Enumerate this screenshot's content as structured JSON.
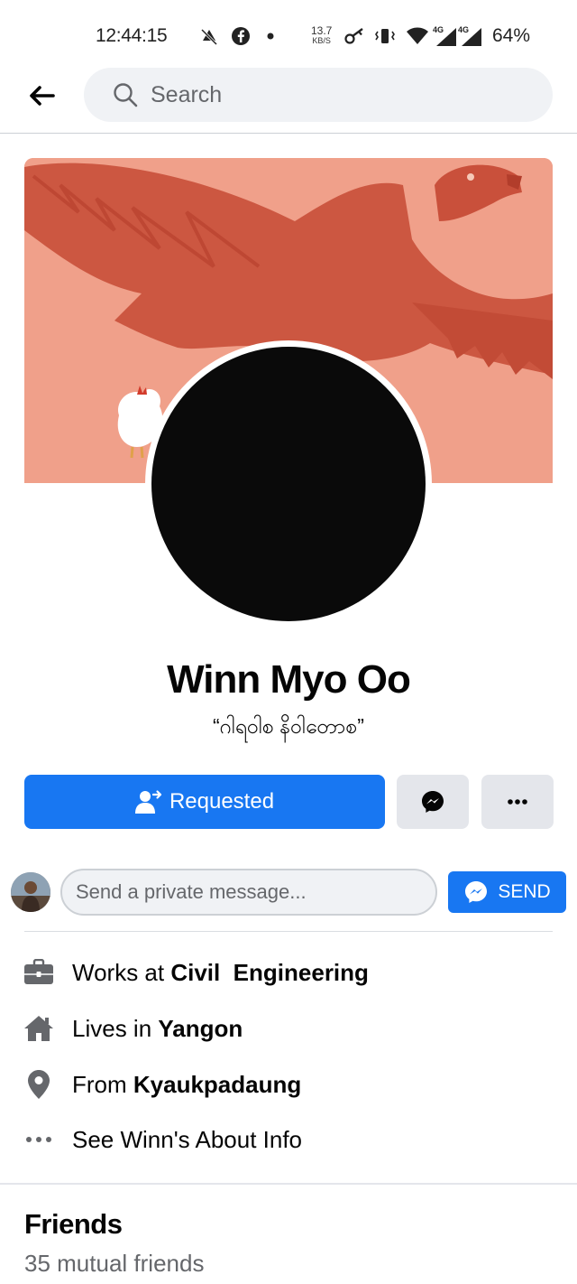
{
  "status_bar": {
    "time": "12:44:15",
    "speed_value": "13.7",
    "speed_unit": "KB/S",
    "network_1": "4G",
    "network_2": "4G",
    "battery": "64%"
  },
  "top_bar": {
    "search_placeholder": "Search"
  },
  "profile": {
    "name": "Winn Myo Oo",
    "bio": "“ဂါရဝါစ နိဝါတောစ”"
  },
  "actions": {
    "requested_label": "Requested"
  },
  "message": {
    "placeholder": "Send a private message...",
    "send_label": "SEND"
  },
  "info": {
    "work_prefix": "Works at ",
    "work_value": "Civil  Engineering",
    "lives_prefix": "Lives in ",
    "lives_value": "Yangon",
    "from_prefix": "From ",
    "from_value": "Kyaukpadaung",
    "about_label": "See Winn's About Info"
  },
  "friends": {
    "title": "Friends",
    "mutual": "35 mutual friends"
  },
  "colors": {
    "accent": "#1877f2",
    "cover": "#ef9c85",
    "secondary_button": "#e4e6eb",
    "muted_text": "#65676b"
  }
}
